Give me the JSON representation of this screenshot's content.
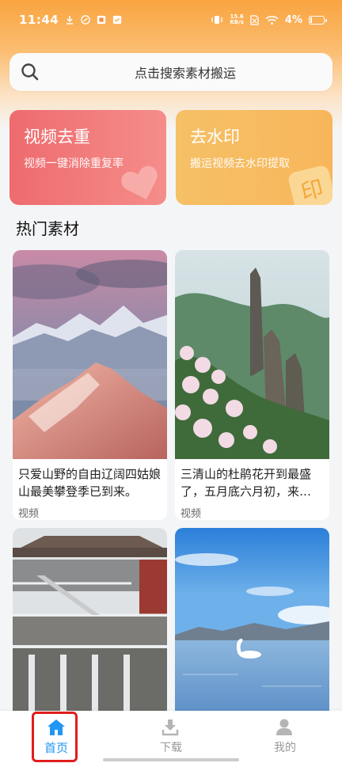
{
  "status_bar": {
    "time": "11:44",
    "speed_value": "15.6",
    "speed_unit": "KB/s",
    "battery": "4%"
  },
  "search": {
    "placeholder": "点击搜索素材搬运"
  },
  "feature_cards": [
    {
      "title": "视频去重",
      "subtitle": "视频一键消除重复率",
      "color": "#ee6b6e"
    },
    {
      "title": "去水印",
      "subtitle": "搬运视频去水印提取",
      "color": "#f6c066",
      "deco_text": "印"
    }
  ],
  "section": {
    "title": "热门素材"
  },
  "materials": [
    {
      "title": "只爱山野的自由辽阔四姑娘山最美攀登季已到来。",
      "tag": "视频"
    },
    {
      "title": "三清山的杜鹃花开到最盛了，五月底六月初，来…",
      "tag": "视频"
    },
    {
      "title": "",
      "tag": ""
    },
    {
      "title": "",
      "tag": ""
    }
  ],
  "tabbar": {
    "items": [
      {
        "label": "首页",
        "icon": "home-icon",
        "active": true
      },
      {
        "label": "下载",
        "icon": "download-icon",
        "active": false
      },
      {
        "label": "我的",
        "icon": "user-icon",
        "active": false
      }
    ]
  },
  "colors": {
    "accent": "#2196f3",
    "header_gradient": "#f9a43f",
    "highlight": "#e11d1d"
  }
}
